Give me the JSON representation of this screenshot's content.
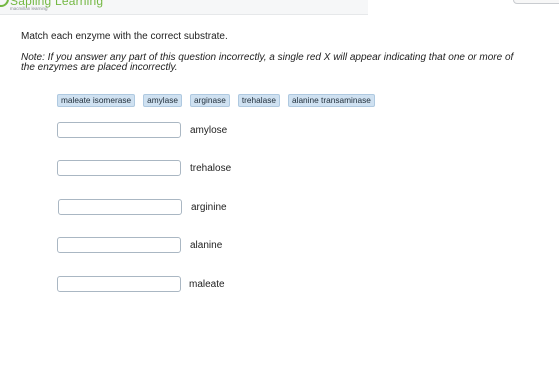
{
  "brand": {
    "name": "Sapling Learning",
    "tagline": "macmillan learning",
    "accent": "#74b843"
  },
  "question": {
    "instruction": "Match each enzyme with the correct substrate.",
    "note": "Note: If you answer any part of this question incorrectly, a single red X will appear indicating that one or more of the enzymes are placed incorrectly."
  },
  "enzymes": [
    "maleate isomerase",
    "amylase",
    "arginase",
    "trehalase",
    "alanine transaminase"
  ],
  "substrates": [
    {
      "label": "amylose",
      "answer": ""
    },
    {
      "label": "trehalose",
      "answer": ""
    },
    {
      "label": "arginine",
      "answer": ""
    },
    {
      "label": "alanine",
      "answer": ""
    },
    {
      "label": "maleate",
      "answer": ""
    }
  ],
  "colors": {
    "chip_bg": "#cfe1f1",
    "chip_border": "#afc9e0",
    "drop_border": "#aab7c3"
  }
}
